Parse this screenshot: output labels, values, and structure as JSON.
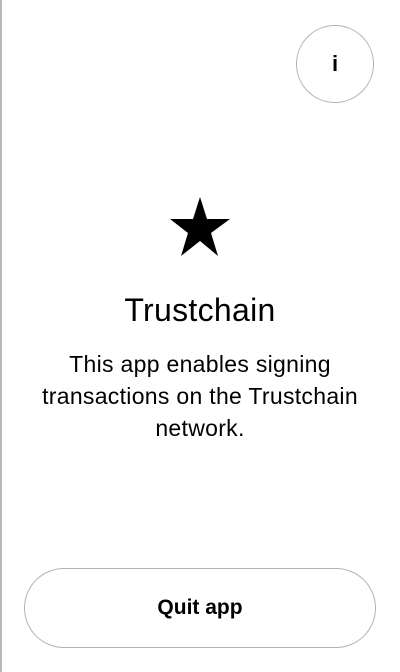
{
  "info_button": {
    "label": "i",
    "icon": "info-icon"
  },
  "app": {
    "icon": "star-icon",
    "title": "Trustchain",
    "description": "This app enables signing transactions on the Trustchain network."
  },
  "quit_button": {
    "label": "Quit app"
  },
  "colors": {
    "background": "#ffffff",
    "text": "#000000",
    "border": "#b3b3b3"
  }
}
